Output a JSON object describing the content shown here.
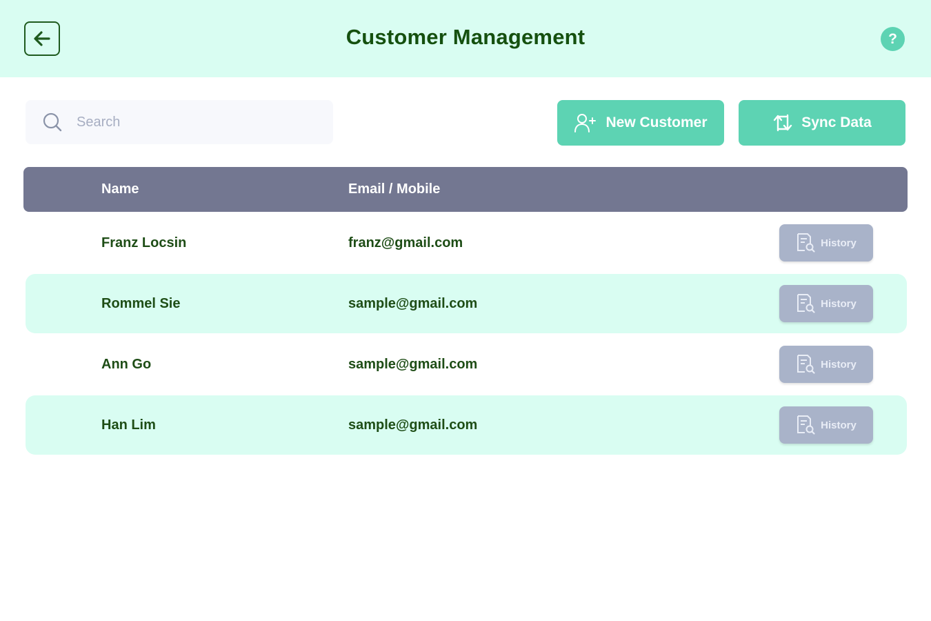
{
  "header": {
    "title": "Customer Management",
    "back_icon": "arrow-left-icon",
    "help_label": "?",
    "background": "#d9fdf2"
  },
  "toolbar": {
    "search_placeholder": "Search",
    "search_value": "",
    "new_customer_label": "New Customer",
    "sync_data_label": "Sync Data",
    "accent": "#5dd3b3"
  },
  "table": {
    "columns": [
      "Name",
      "Email / Mobile"
    ],
    "header_color": "#737791",
    "rows": [
      {
        "name": "Franz Locsin",
        "email": "franz@gmail.com",
        "action": "History"
      },
      {
        "name": "Rommel Sie",
        "email": "sample@gmail.com",
        "action": "History"
      },
      {
        "name": "Ann Go",
        "email": "sample@gmail.com",
        "action": "History"
      },
      {
        "name": "Han Lim",
        "email": "sample@gmail.com",
        "action": "History"
      }
    ]
  }
}
